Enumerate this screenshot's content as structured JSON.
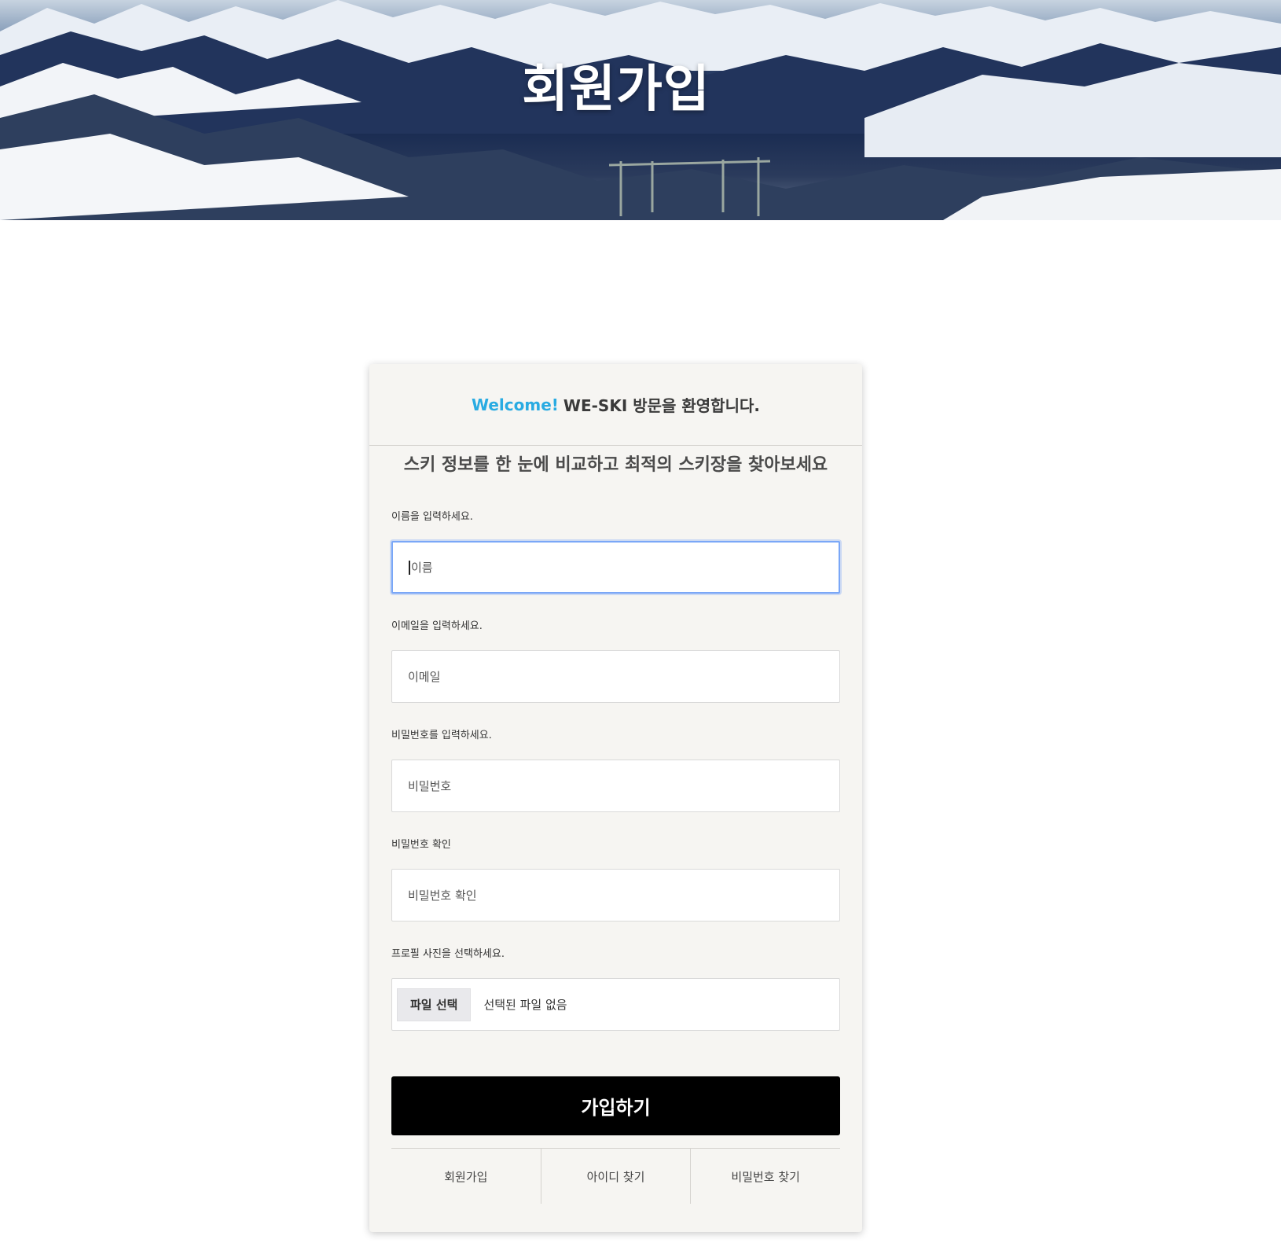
{
  "hero": {
    "title": "회원가입"
  },
  "card": {
    "welcome_accent": "Welcome!",
    "welcome_text": "WE-SKI 방문을 환영합니다.",
    "tagline": "스키 정보를 한 눈에 비교하고 최적의 스키장을 찾아보세요"
  },
  "form": {
    "name": {
      "label": "이름을 입력하세요.",
      "placeholder": "이름"
    },
    "email": {
      "label": "이메일을 입력하세요.",
      "placeholder": "이메일"
    },
    "password": {
      "label": "비밀번호를 입력하세요.",
      "placeholder": "비밀번호"
    },
    "password_confirm": {
      "label": "비밀번호 확인",
      "placeholder": "비밀번호 확인"
    },
    "profile": {
      "label": "프로필 사진을 선택하세요.",
      "button": "파일 선택",
      "status": "선택된 파일 없음"
    },
    "submit_label": "가입하기"
  },
  "links": {
    "signup": "회원가입",
    "find_id": "아이디 찾기",
    "find_password": "비밀번호 찾기"
  },
  "colors": {
    "accent": "#29abe2",
    "submit_bg": "#000000",
    "card_bg": "#f6f5f2",
    "focus_ring": "#7aa7f7"
  },
  "icons": {
    "hero_image": "snowy-mountains-image"
  }
}
